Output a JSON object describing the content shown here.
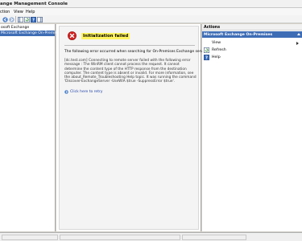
{
  "window": {
    "title": "ange Management Console"
  },
  "menu": {
    "items": [
      "ction",
      "View",
      "Help"
    ]
  },
  "toolbar": {
    "buttons": [
      {
        "name": "back-icon"
      },
      {
        "name": "forward-icon"
      },
      {
        "name": "show-hide-tree-icon"
      },
      {
        "name": "refresh-icon"
      },
      {
        "name": "help-icon"
      },
      {
        "name": "action-pane-icon"
      }
    ]
  },
  "tree": {
    "items": [
      {
        "label": "osoft Exchange",
        "selected": false
      },
      {
        "label": "Microsoft Exchange On-Premises",
        "selected": true
      }
    ]
  },
  "content": {
    "error_title": "Initialization failed",
    "description": "The following error occurred when searching for On-Premises Exchange server:",
    "detail": "[dc.test.com] Connecting to remote server failed with the following error message : The WinRM client cannot process the request. It cannot determine the content type of the HTTP response from the destination computer. The content type is absent or invalid. For more information, see the about_Remote_Troubleshooting Help topic. It was running the command 'Discover-ExchangeServer -UseWIA $true -SuppressError $true'.",
    "retry_label": "Click here to retry"
  },
  "actions": {
    "header": "Actions",
    "section_title": "Microsoft Exchange On-Premises",
    "items": [
      {
        "label": "View",
        "has_submenu": true,
        "icon": ""
      },
      {
        "label": "Refresh",
        "has_submenu": false,
        "icon": "refresh-icon"
      },
      {
        "label": "Help",
        "has_submenu": false,
        "icon": "help-icon"
      }
    ]
  },
  "colors": {
    "selection": "#3e6db5",
    "highlight": "#fff45c",
    "error_red": "#d42020",
    "link": "#2244aa"
  }
}
